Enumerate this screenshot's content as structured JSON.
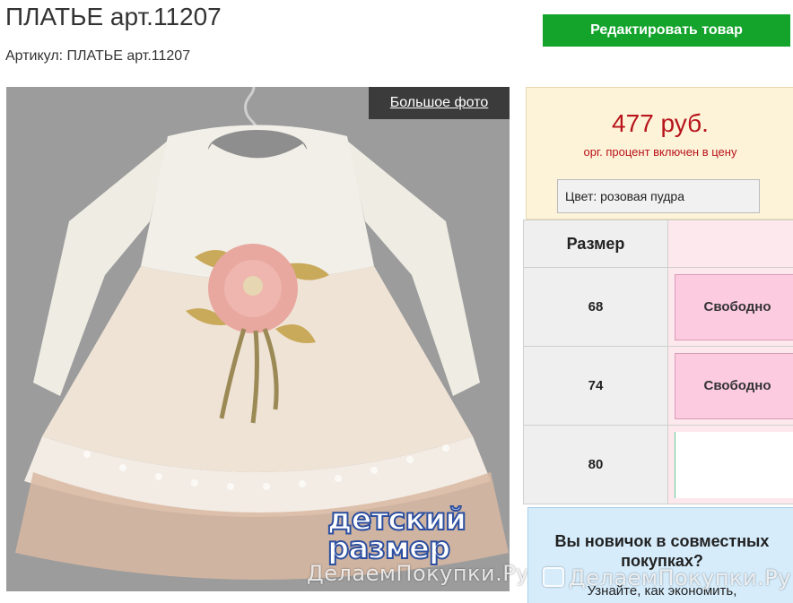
{
  "product": {
    "title": "ПЛАТЬЕ арт.11207",
    "sku_line": "Артикул: ПЛАТЬЕ арт.11207"
  },
  "toolbar": {
    "edit_label": "Редактировать товар"
  },
  "photo": {
    "big_photo_label": "Большое фото",
    "logo_line1": "детский",
    "logo_line2": "размер",
    "watermark": "ДелаемПокупки.Ру"
  },
  "price_box": {
    "price": "477 руб.",
    "note": "орг. процент включен в цену",
    "color_label": "Цвет:  розовая пудра"
  },
  "sizes": {
    "header": "Размер",
    "rows": [
      {
        "size": "68",
        "status": "Свободно"
      },
      {
        "size": "74",
        "status": "Свободно"
      },
      {
        "size": "80",
        "status": ""
      }
    ]
  },
  "newbie": {
    "title": "Вы новичок в совместных покупках?",
    "text": "Узнайте, как экономить,"
  },
  "footer_watermark": "ДелаемПокупки.Ру",
  "colors": {
    "accent_green": "#14a42c",
    "price_red": "#b8141c",
    "price_box_bg": "#fdf3d8",
    "size_available_bg": "#fccbe0",
    "newbie_bg": "#d6ecfb"
  }
}
